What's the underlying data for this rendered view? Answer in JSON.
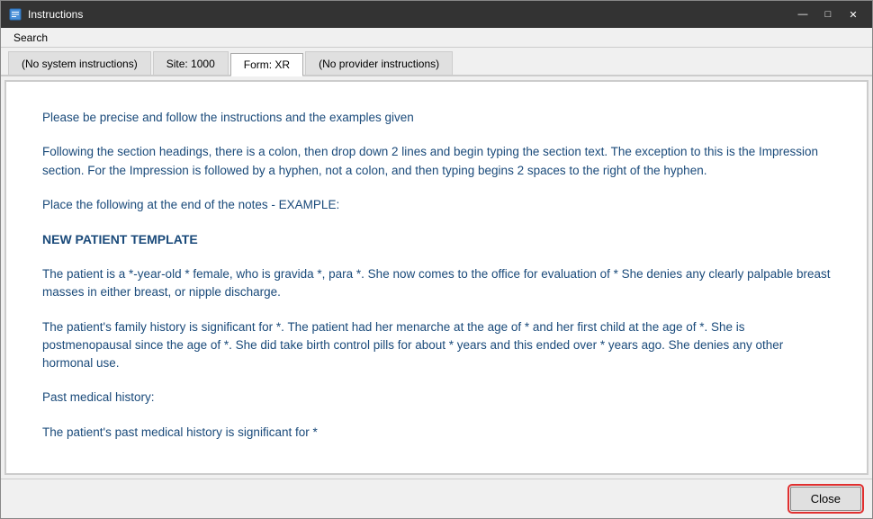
{
  "window": {
    "title": "Instructions",
    "icon": "document-icon"
  },
  "titlebar": {
    "minimize_label": "—",
    "maximize_label": "□",
    "close_label": "✕"
  },
  "menubar": {
    "items": [
      {
        "label": "Search"
      }
    ]
  },
  "tabs": [
    {
      "id": "no-system",
      "label": "(No system instructions)",
      "active": false
    },
    {
      "id": "site-1000",
      "label": "Site: 1000",
      "active": false
    },
    {
      "id": "form-xr",
      "label": "Form: XR",
      "active": true
    },
    {
      "id": "no-provider",
      "label": "(No provider instructions)",
      "active": false
    }
  ],
  "content": {
    "paragraphs": [
      {
        "id": "p1",
        "text": "Please be precise and follow the instructions and the examples given"
      },
      {
        "id": "p2",
        "text": "Following the section headings, there is a colon, then drop down 2 lines and begin typing the section text.  The exception to this is the Impression section.  For the Impression is followed by a hyphen, not a colon, and then typing begins 2 spaces to the right of the hyphen."
      },
      {
        "id": "p3",
        "text": "Place the following at the end of the notes - EXAMPLE:"
      },
      {
        "id": "template-title",
        "text": "NEW PATIENT TEMPLATE",
        "isTitle": true
      },
      {
        "id": "p4",
        "text": "The patient is a *-year-old * female, who is gravida *, para *.  She now comes to the office for evaluation of *  She denies any clearly palpable breast masses in either breast, or nipple discharge."
      },
      {
        "id": "p5",
        "text": "The patient's family history is significant for *.  The patient had her menarche at the age of * and her first child at the age of *.  She is postmenopausal since the age of *.  She did take birth control pills for about * years and this ended over * years ago.  She denies any other hormonal use."
      },
      {
        "id": "p6",
        "text": "Past medical history:"
      },
      {
        "id": "p7",
        "text": "The patient's past medical history is significant for *"
      }
    ]
  },
  "bottombar": {
    "close_label": "Close"
  }
}
